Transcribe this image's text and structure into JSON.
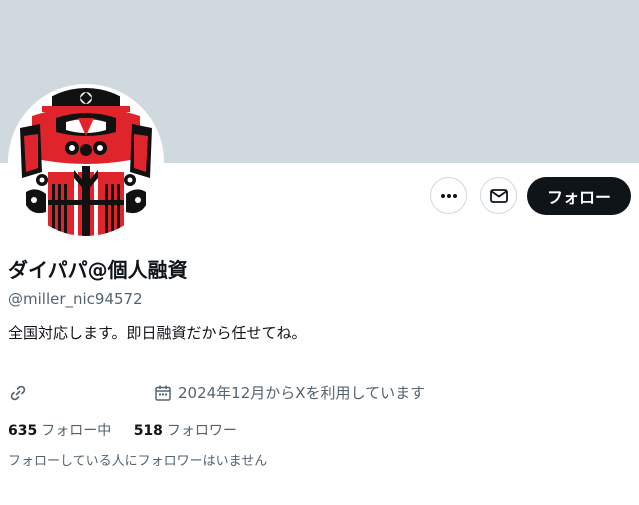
{
  "profile": {
    "display_name": "ダイパパ@個人融資",
    "handle": "@miller_nic94572",
    "bio": "全国対応します。即日融資だから任せてね。",
    "joined": "2024年12月からXを利用しています"
  },
  "actions": {
    "more_icon": "more-horizontal-icon",
    "message_icon": "mail-icon",
    "follow_label": "フォロー"
  },
  "stats": {
    "following_count": "635",
    "following_label": "フォロー中",
    "followers_count": "518",
    "followers_label": "フォロワー"
  },
  "followers_you_know": "フォローしている人にフォロワーはいません",
  "icons": {
    "link": "link-icon",
    "calendar": "calendar-icon"
  },
  "colors": {
    "banner": "#cfd9de",
    "text_primary": "#0f1419",
    "text_secondary": "#536471",
    "follow_button_bg": "#0f1419",
    "avatar_red": "#e0242b"
  }
}
